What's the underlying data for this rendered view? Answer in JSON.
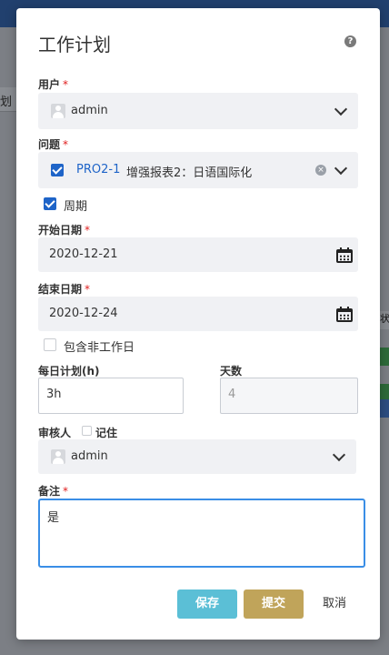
{
  "background": {
    "header_color": "#21406e",
    "left_fragment": "划",
    "right_fragment": "状"
  },
  "modal": {
    "title": "工作计划",
    "help_icon": "?",
    "user": {
      "label": "用户",
      "value": "admin"
    },
    "issue": {
      "label": "问题",
      "key": "PRO2-1",
      "summary": "增强报表2：日语国际化",
      "checked": true
    },
    "periodic": {
      "label": "周期",
      "checked": true
    },
    "start_date": {
      "label": "开始日期",
      "value": "2020-12-21"
    },
    "end_date": {
      "label": "结束日期",
      "value": "2020-12-24"
    },
    "include_nonworking": {
      "label": "包含非工作日",
      "checked": false
    },
    "daily_plan": {
      "label": "每日计划(h)",
      "value": "3h"
    },
    "days": {
      "label": "天数",
      "value": "4"
    },
    "reviewer": {
      "label": "审核人",
      "remember_label": "记住",
      "remember_checked": false,
      "value": "admin"
    },
    "remark": {
      "label": "备注",
      "value": "是"
    },
    "required_mark": "*",
    "buttons": {
      "save": "保存",
      "submit": "提交",
      "cancel": "取消"
    }
  },
  "colors": {
    "primary": "#1e64c8",
    "save": "#5bbfd6",
    "submit": "#c0a45a",
    "required": "#e02020",
    "focus_border": "#3a8ee6"
  }
}
